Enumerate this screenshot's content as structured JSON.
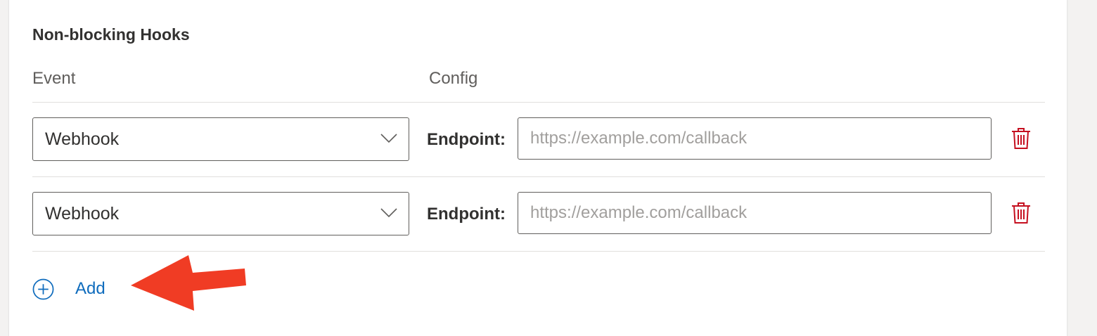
{
  "section": {
    "title": "Non-blocking Hooks"
  },
  "columns": {
    "event": "Event",
    "config": "Config"
  },
  "hooks": [
    {
      "event": "Webhook",
      "endpoint_label": "Endpoint:",
      "endpoint_value": "",
      "endpoint_placeholder": "https://example.com/callback"
    },
    {
      "event": "Webhook",
      "endpoint_label": "Endpoint:",
      "endpoint_value": "",
      "endpoint_placeholder": "https://example.com/callback"
    }
  ],
  "add_button": {
    "label": "Add",
    "icon": "add-circle-icon"
  },
  "icons": {
    "dropdown": "chevron-down-icon",
    "delete": "trash-icon",
    "annotation": "red-arrow-annotation"
  },
  "colors": {
    "accent": "#0f6cbd",
    "delete": "#c50f1f",
    "annotation_arrow": "#f03c24",
    "text": "#323130",
    "placeholder": "#a19f9d",
    "border": "#605e5c"
  }
}
